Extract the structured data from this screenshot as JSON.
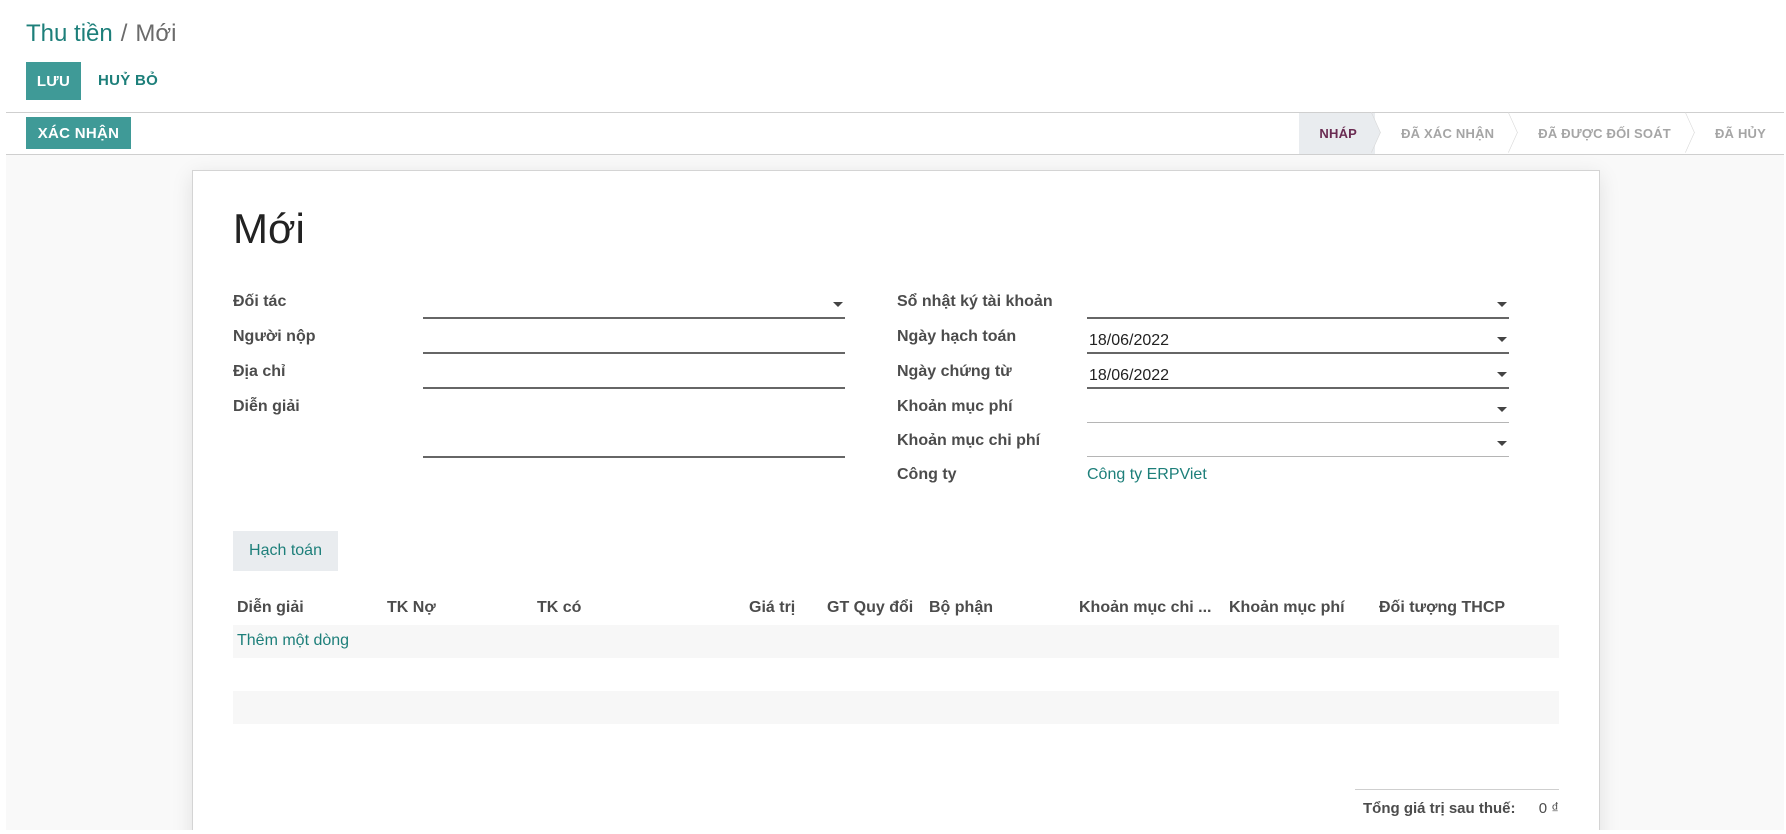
{
  "breadcrumb": {
    "parent": "Thu tiền",
    "separator": "/",
    "current": "Mới"
  },
  "toolbar": {
    "save_label": "LƯU",
    "discard_label": "HUỶ BỎ"
  },
  "statusbar": {
    "confirm_label": "XÁC NHẬN",
    "stages": [
      "NHÁP",
      "ĐÃ XÁC NHẬN",
      "ĐÃ ĐƯỢC ĐỐI SOÁT",
      "ĐÃ HỦY"
    ],
    "active_stage": "NHÁP"
  },
  "form": {
    "title": "Mới",
    "left": {
      "partner_label": "Đối tác",
      "payer_label": "Người nộp",
      "address_label": "Địa chỉ",
      "description_label": "Diễn giải"
    },
    "right": {
      "journal_label": "Sổ nhật ký tài khoản",
      "accounting_date_label": "Ngày hạch toán",
      "accounting_date_value": "18/06/2022",
      "document_date_label": "Ngày chứng từ",
      "document_date_value": "18/06/2022",
      "fee_item_label": "Khoản mục phí",
      "expense_item_label": "Khoản mục chi phí",
      "company_label": "Công ty",
      "company_value": "Công ty ERPViet"
    }
  },
  "notebook": {
    "tab_label": "Hạch toán"
  },
  "lines": {
    "columns": [
      "Diễn giải",
      "TK Nợ",
      "TK có",
      "Giá trị",
      "GT Quy đổi",
      "Bộ phận",
      "Khoản mục chi ...",
      "Khoản mục phí",
      "Đối tượng THCP"
    ],
    "add_line_label": "Thêm một dòng"
  },
  "totals": {
    "label": "Tổng giá trị sau thuế:",
    "value": "0 ₫"
  },
  "colors": {
    "primary": "#3f9a97",
    "link": "#1d7f7a",
    "active_stage": "#6a2b52"
  }
}
